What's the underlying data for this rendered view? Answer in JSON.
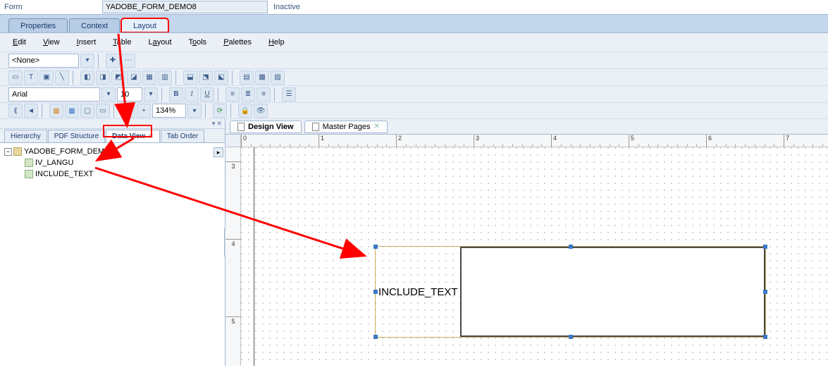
{
  "header": {
    "label": "Form",
    "value": "YADOBE_FORM_DEMO8",
    "status": "Inactive"
  },
  "outer_tabs": {
    "items": [
      {
        "label": "Properties"
      },
      {
        "label": "Context"
      },
      {
        "label": "Layout"
      }
    ],
    "active": 2
  },
  "menu": {
    "items": [
      "Edit",
      "View",
      "Insert",
      "Table",
      "Layout",
      "Tools",
      "Palettes",
      "Help"
    ]
  },
  "toolbar": {
    "style_value": "<None>",
    "font_value": "Arial",
    "font_size": "10",
    "zoom_value": "134%"
  },
  "left_panel": {
    "tabs": [
      "Hierarchy",
      "PDF Structure",
      "Data View",
      "Tab Order"
    ],
    "active": 2,
    "tree": {
      "root": "YADOBE_FORM_DEMO8",
      "children": [
        {
          "label": "IV_LANGU"
        },
        {
          "label": "INCLUDE_TEXT"
        }
      ]
    }
  },
  "right_panel": {
    "tabs": [
      {
        "label": "Design View"
      },
      {
        "label": "Master Pages"
      }
    ],
    "active": 0,
    "hruler": [
      "0",
      "1",
      "2",
      "3",
      "4",
      "5",
      "6",
      "7"
    ],
    "vruler": [
      "3",
      "4",
      "5"
    ],
    "placed_object_label": "INCLUDE_TEXT"
  }
}
